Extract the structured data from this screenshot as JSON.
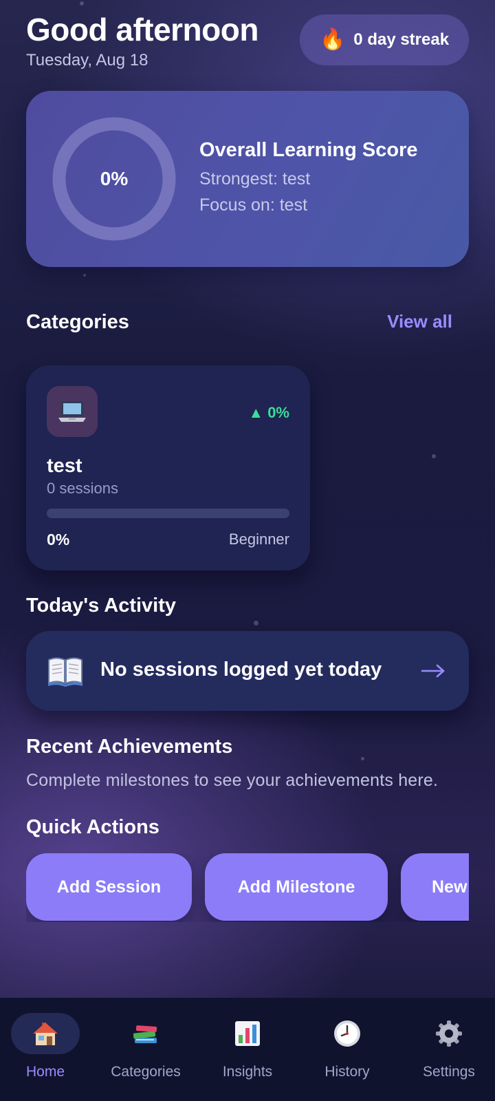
{
  "header": {
    "greeting": "Good afternoon",
    "date": "Tuesday, Aug 18",
    "streak_icon": "fire-icon",
    "streak_label": "0 day streak"
  },
  "score_card": {
    "percent_label": "0%",
    "progress": 0,
    "title": "Overall Learning Score",
    "strongest": "Strongest: test",
    "focus": "Focus on: test"
  },
  "categories": {
    "title": "Categories",
    "view_all": "View all",
    "items": [
      {
        "icon": "laptop-icon",
        "change": "▲ 0%",
        "name": "test",
        "sessions": "0 sessions",
        "progress": 0,
        "percent": "0%",
        "level": "Beginner"
      }
    ]
  },
  "activity": {
    "title": "Today's Activity",
    "icon": "book-icon",
    "message": "No sessions logged yet today",
    "arrow_icon": "arrow-right-icon"
  },
  "achievements": {
    "title": "Recent Achievements",
    "empty": "Complete milestones to see your achievements here."
  },
  "quick_actions": {
    "title": "Quick Actions",
    "buttons": [
      "Add Session",
      "Add Milestone",
      "New"
    ]
  },
  "nav": {
    "items": [
      {
        "label": "Home",
        "icon": "home-icon",
        "active": true
      },
      {
        "label": "Categories",
        "icon": "books-icon",
        "active": false
      },
      {
        "label": "Insights",
        "icon": "bar-chart-icon",
        "active": false
      },
      {
        "label": "History",
        "icon": "clock-icon",
        "active": false
      },
      {
        "label": "Settings",
        "icon": "gear-icon",
        "active": false
      }
    ]
  },
  "colors": {
    "accent": "#8c7cf8",
    "positive": "#3ddc97"
  }
}
